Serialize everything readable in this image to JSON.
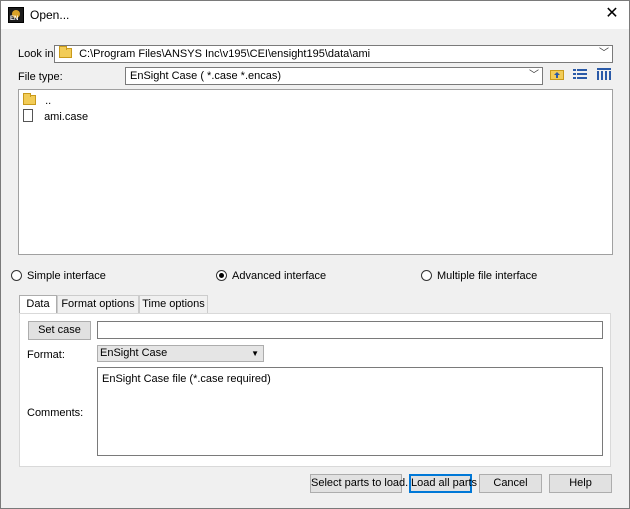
{
  "window": {
    "title": "Open...",
    "close_glyph": "✕"
  },
  "look_in": {
    "label": "Look in:",
    "path": "C:\\Program Files\\ANSYS Inc\\v195\\CEI\\ensight195\\data\\ami"
  },
  "file_type": {
    "label": "File type:",
    "value": "EnSight Case ( *.case *.encas)"
  },
  "toolbar": {
    "up_icon": "folder-up-icon",
    "list_view_icon": "list-view-icon",
    "detail_view_icon": "detail-view-icon"
  },
  "files": [
    {
      "name": "..",
      "type": "folder"
    },
    {
      "name": "ami.case",
      "type": "file"
    }
  ],
  "interface_modes": [
    {
      "label": "Simple interface",
      "selected": false
    },
    {
      "label": "Advanced interface",
      "selected": true
    },
    {
      "label": "Multiple file interface",
      "selected": false
    }
  ],
  "tabs": [
    {
      "label": "Data",
      "active": true
    },
    {
      "label": "Format options",
      "active": false
    },
    {
      "label": "Time options",
      "active": false
    }
  ],
  "data_tab": {
    "set_case_label": "Set case",
    "set_case_value": "",
    "format_label": "Format:",
    "format_value": "EnSight Case",
    "comments_label": "Comments:",
    "comments_value": "EnSight Case file (*.case required)"
  },
  "buttons": {
    "select_parts": "Select parts to load...",
    "load_all": "Load all parts",
    "cancel": "Cancel",
    "help": "Help"
  }
}
